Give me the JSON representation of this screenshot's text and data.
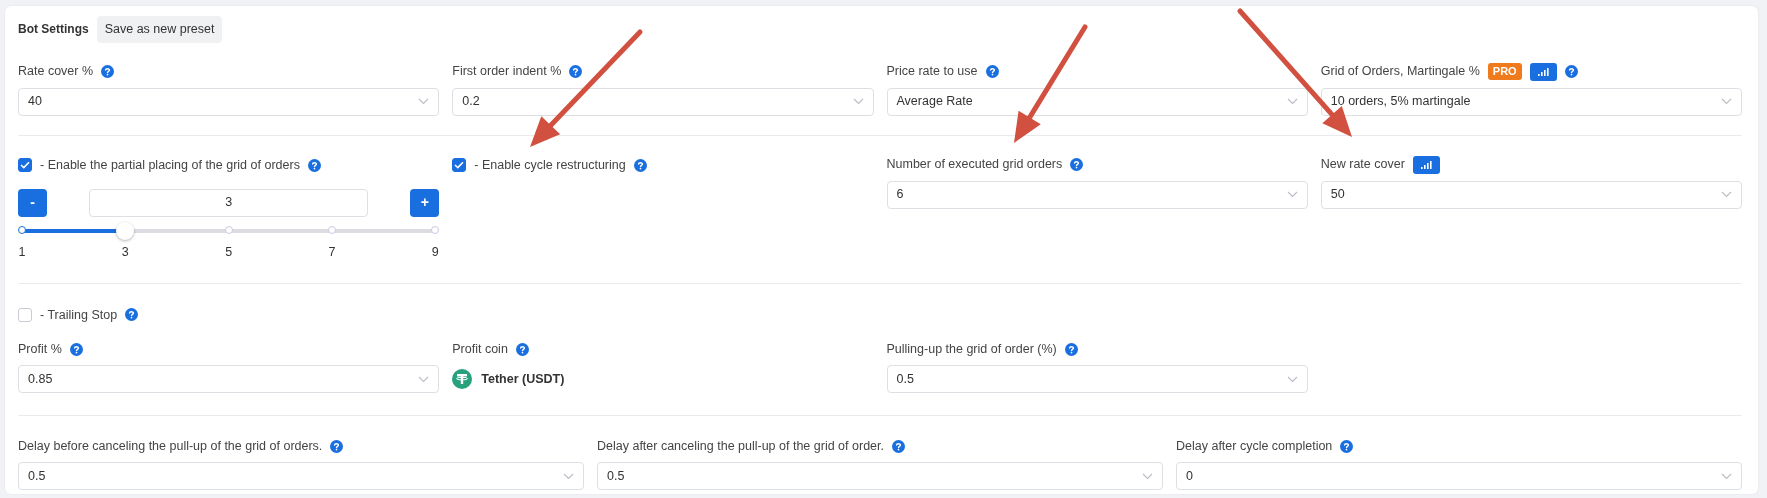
{
  "header": {
    "title": "Bot Settings",
    "preset_button": "Save as new preset"
  },
  "main_settings": [
    {
      "label": "Rate cover %",
      "help": true,
      "value": "40"
    },
    {
      "label": "First order indent %",
      "help": true,
      "value": "0.2"
    },
    {
      "label": "Price rate to use",
      "help": true,
      "value": "Average Rate"
    },
    {
      "label": "Grid of Orders, Martingale %",
      "pro_badge": "PRO",
      "stats_button": true,
      "help": true,
      "value": "10 orders, 5% martingale"
    }
  ],
  "restructuring": {
    "partial_placing": {
      "label": "- Enable the partial placing of the grid of orders",
      "checked": true,
      "help": true,
      "minus": "-",
      "value": "3",
      "plus": "+",
      "slider": {
        "level": 0.25,
        "ticks": [
          "1",
          "3",
          "5",
          "7",
          "9"
        ]
      }
    },
    "cycle_restructuring": {
      "label": "- Enable cycle restructuring",
      "checked": true,
      "help": true
    },
    "fields": [
      {
        "label": "Number of executed grid orders",
        "help": true,
        "stats_button": false,
        "value": "6"
      },
      {
        "label": "New rate cover",
        "help": false,
        "stats_button": true,
        "value": "50"
      }
    ]
  },
  "trailing": {
    "toggle": {
      "label": "- Trailing Stop",
      "checked": false,
      "help": true
    },
    "fields": [
      {
        "kind": "select",
        "label": "Profit %",
        "help": true,
        "value": "0.85"
      },
      {
        "kind": "coin",
        "label": "Profit coin",
        "help": true,
        "value": "Tether (USDT)"
      },
      {
        "kind": "select",
        "label": "Pulling-up the grid of order (%)",
        "help": true,
        "value": "0.5"
      }
    ]
  },
  "delays": [
    {
      "label": "Delay before canceling the pull-up of the grid of orders.",
      "help": true,
      "value": "0.5"
    },
    {
      "label": "Delay after canceling the pull-up of the grid of order.",
      "help": true,
      "value": "0.5"
    },
    {
      "label": "Delay after cycle completion",
      "help": true,
      "value": "0"
    }
  ]
}
